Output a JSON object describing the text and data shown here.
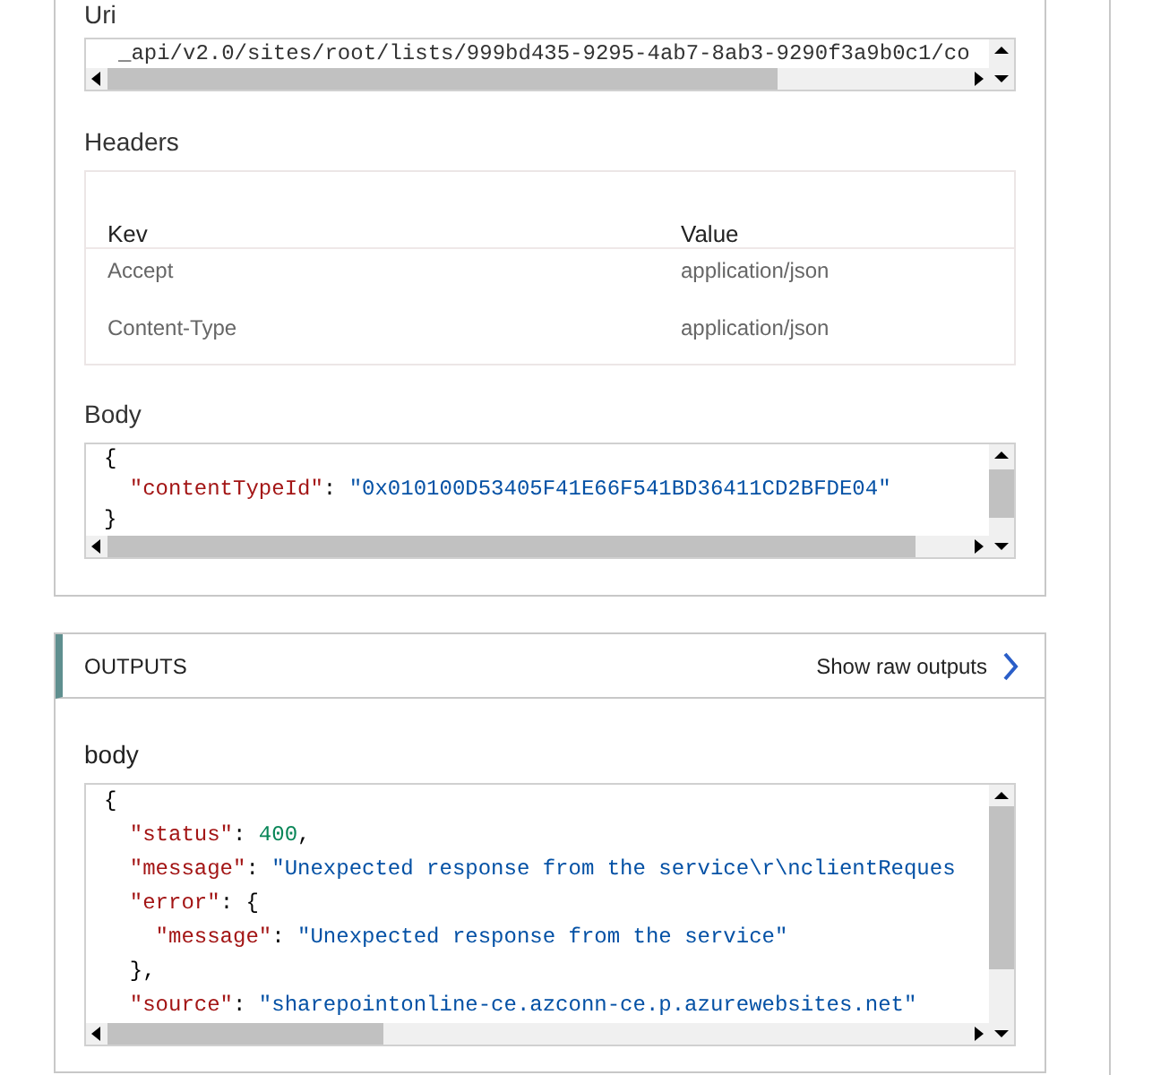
{
  "request": {
    "uri": {
      "label": "Uri",
      "value": "_api/v2.0/sites/root/lists/999bd435-9295-4ab7-8ab3-9290f3a9b0c1/co"
    },
    "headers": {
      "label": "Headers",
      "columns": [
        "Kev",
        "Value"
      ],
      "rows": [
        {
          "key": "Accept",
          "value": "application/json"
        },
        {
          "key": "Content-Type",
          "value": "application/json"
        }
      ]
    },
    "body": {
      "label": "Body",
      "lines": [
        [
          {
            "kind": "punct",
            "text": "{"
          }
        ],
        [
          {
            "kind": "key",
            "text": "  \"contentTypeId\""
          },
          {
            "kind": "punct",
            "text": ": "
          },
          {
            "kind": "string",
            "text": "\"0x010100D53405F41E66F541BD36411CD2BFDE04\""
          }
        ],
        [
          {
            "kind": "punct",
            "text": "}"
          }
        ]
      ]
    }
  },
  "outputs": {
    "title": "OUTPUTS",
    "raw_link": "Show raw outputs",
    "body": {
      "label": "body",
      "lines": [
        [
          {
            "kind": "punct",
            "text": "{"
          }
        ],
        [
          {
            "kind": "key",
            "text": "  \"status\""
          },
          {
            "kind": "punct",
            "text": ": "
          },
          {
            "kind": "number",
            "text": "400"
          },
          {
            "kind": "punct",
            "text": ","
          }
        ],
        [
          {
            "kind": "key",
            "text": "  \"message\""
          },
          {
            "kind": "punct",
            "text": ": "
          },
          {
            "kind": "string",
            "text": "\"Unexpected response from the service\\r\\nclientReques"
          }
        ],
        [
          {
            "kind": "key",
            "text": "  \"error\""
          },
          {
            "kind": "punct",
            "text": ": {"
          }
        ],
        [
          {
            "kind": "key",
            "text": "    \"message\""
          },
          {
            "kind": "punct",
            "text": ": "
          },
          {
            "kind": "string",
            "text": "\"Unexpected response from the service\""
          }
        ],
        [
          {
            "kind": "punct",
            "text": "  },"
          }
        ],
        [
          {
            "kind": "key",
            "text": "  \"source\""
          },
          {
            "kind": "punct",
            "text": ": "
          },
          {
            "kind": "string",
            "text": "\"sharepointonline-ce.azconn-ce.p.azurewebsites.net\""
          }
        ]
      ]
    }
  }
}
